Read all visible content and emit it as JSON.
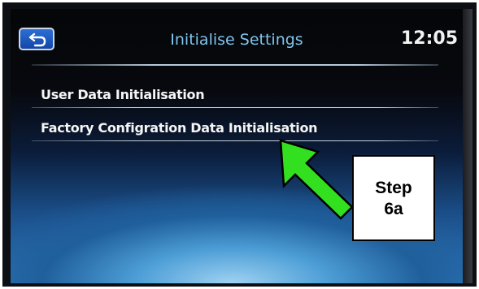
{
  "header": {
    "title": "Initialise Settings",
    "clock": "12:05"
  },
  "menu": {
    "items": [
      {
        "label": "User Data Initialisation"
      },
      {
        "label": "Factory Configration Data Initialisation"
      }
    ]
  },
  "callout": {
    "line1": "Step",
    "line2": "6a"
  },
  "colors": {
    "accent_title": "#7fc4ee",
    "back_button": "#2c6fd6",
    "arrow": "#33e020"
  },
  "icons": {
    "back": "back-arrow-icon",
    "pointer": "green-arrow-icon"
  }
}
